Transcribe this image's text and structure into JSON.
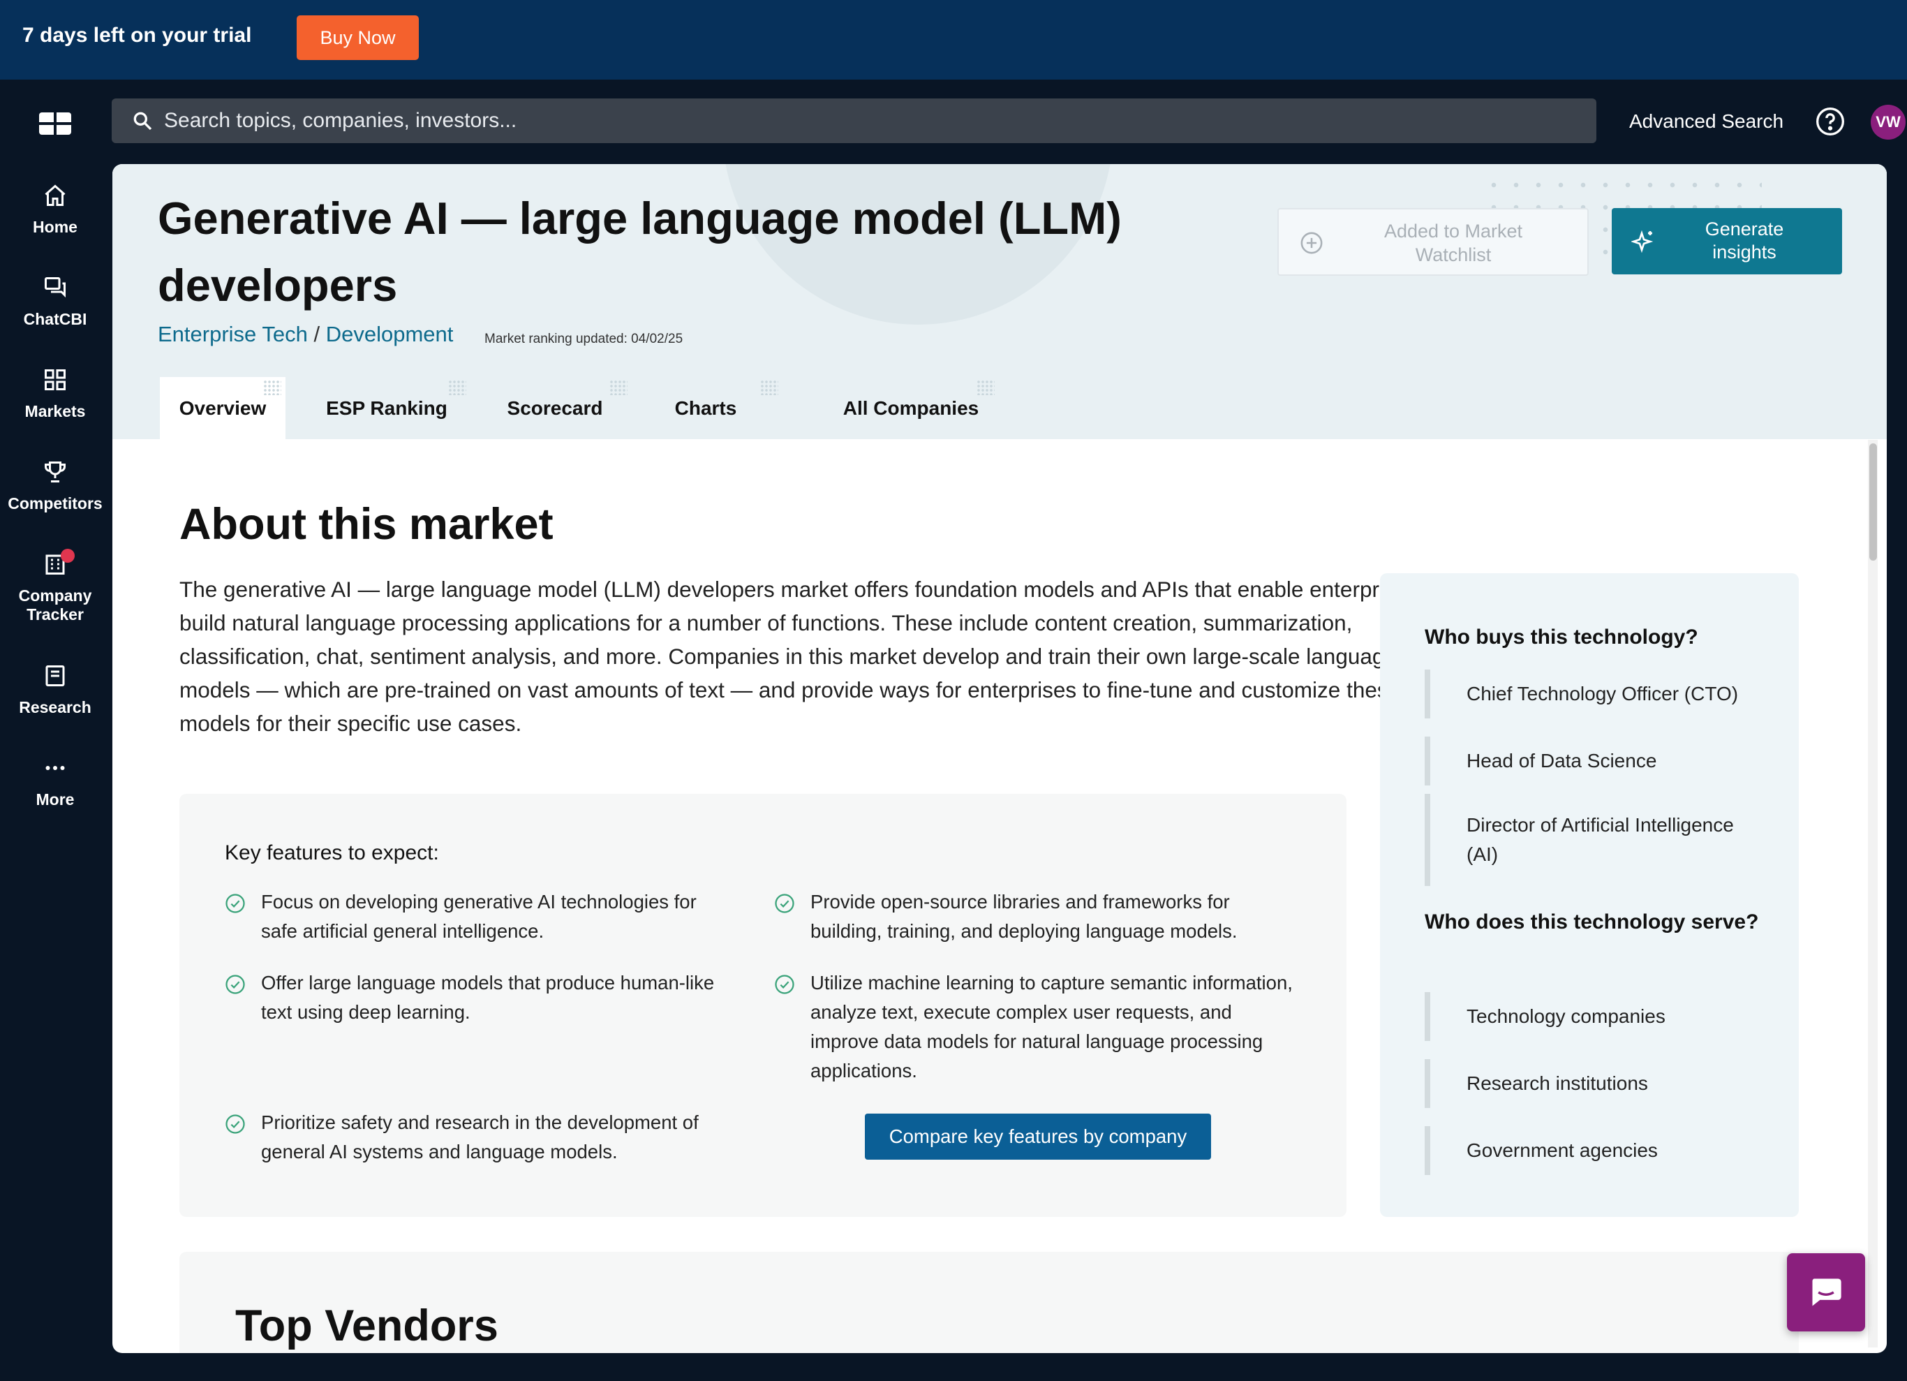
{
  "trial": {
    "text": "7 days left on your trial",
    "buy_label": "Buy Now"
  },
  "nav": {
    "home": "Home",
    "chatcbi": "ChatCBI",
    "markets": "Markets",
    "competitors": "Competitors",
    "company_tracker": "Company Tracker",
    "research": "Research",
    "more": "More"
  },
  "topbar": {
    "search_placeholder": "Search topics, companies, investors...",
    "advanced_search": "Advanced Search",
    "avatar_initials": "VW"
  },
  "header": {
    "title": "Generative AI — large language model (LLM) developers",
    "breadcrumb_parent": "Enterprise Tech",
    "breadcrumb_separator": "/",
    "breadcrumb_child": "Development",
    "ranking_updated": "Market ranking updated: 04/02/25",
    "watchlist_label": "Added to Market Watchlist",
    "generate_label": "Generate insights"
  },
  "tabs": [
    "Overview",
    "ESP Ranking",
    "Scorecard",
    "Charts",
    "All Companies"
  ],
  "about": {
    "title": "About this market",
    "description": "The generative AI — large language model (LLM) developers market offers foundation models and APIs that enable enterprises to build natural language processing applications for a number of functions. These include content creation, summarization, classification, chat, sentiment analysis, and more. Companies in this market develop and train their own large-scale language models — which are pre-trained on vast amounts of text — and provide ways for enterprises to fine-tune and customize these models for their specific use cases."
  },
  "features": {
    "title": "Key features to expect:",
    "items": [
      "Focus on developing generative AI technologies for safe artificial general intelligence.",
      "Provide open-source libraries and frameworks for building, training, and deploying language models.",
      "Offer large language models that produce human-like text using deep learning.",
      "Utilize machine learning to capture semantic information, analyze text, execute complex user requests, and improve data models for natural language processing applications.",
      "Prioritize safety and research in the development of general AI systems and language models."
    ],
    "compare_label": "Compare key features by company"
  },
  "buyers": {
    "title": "Who buys this technology?",
    "items": [
      "Chief Technology Officer (CTO)",
      "Head of Data Science",
      "Director of Artificial Intelligence (AI)"
    ]
  },
  "serves": {
    "title": "Who does this technology serve?",
    "items": [
      "Technology companies",
      "Research institutions",
      "Government agencies"
    ]
  },
  "vendors": {
    "title": "Top Vendors"
  },
  "colors": {
    "accent_teal": "#0f7891",
    "cta_orange": "#f4612d",
    "brand_purple": "#8a1f7d",
    "link_blue": "#0b5f96"
  },
  "icons": [
    "logo-icon",
    "home-icon",
    "chat-icon",
    "markets-icon",
    "trophy-icon",
    "building-icon",
    "research-icon",
    "more-icon",
    "search-icon",
    "help-icon",
    "plus-circle-icon",
    "sparkle-icon",
    "check-circle-icon",
    "chat-bubble-icon"
  ]
}
